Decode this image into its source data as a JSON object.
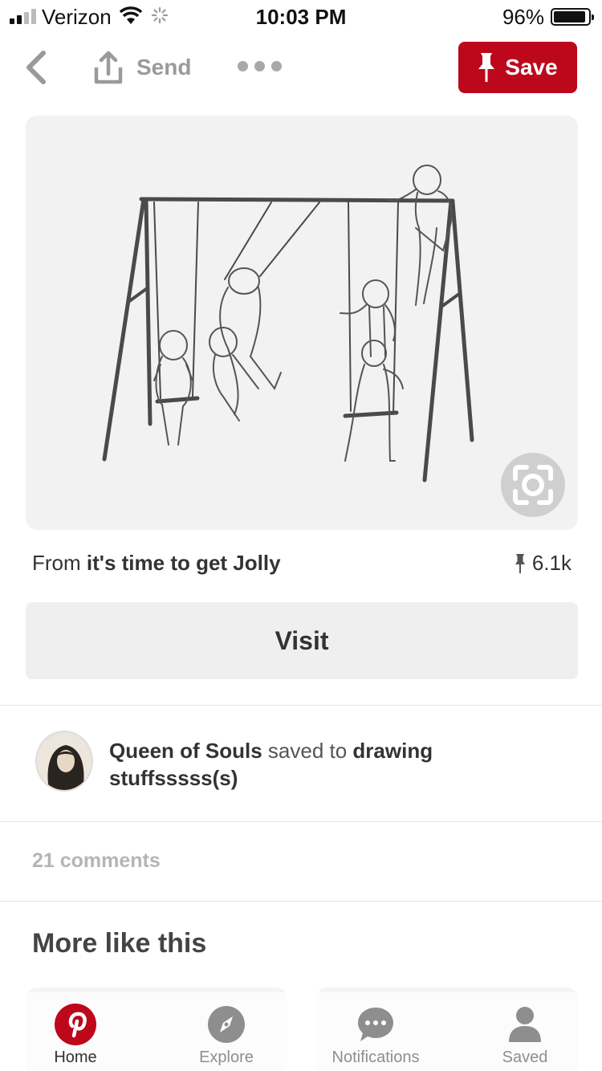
{
  "status_bar": {
    "carrier": "Verizon",
    "time": "10:03 PM",
    "battery": "96%",
    "battery_level": 0.96
  },
  "top_nav": {
    "send_label": "Send",
    "save_label": "Save",
    "save_color": "#bd081c"
  },
  "pin": {
    "source_prefix": "From ",
    "source_name": "it's time to get Jolly",
    "save_count": "6.1k",
    "visit_label": "Visit"
  },
  "attribution": {
    "user_name": "Queen of Souls",
    "saved_to": " saved to ",
    "board_name": "drawing stuffsssss(s)"
  },
  "comments": {
    "label": "21 comments"
  },
  "more_like_this": {
    "title": "More like this"
  },
  "tab_bar": {
    "tabs": [
      {
        "label": "Home",
        "icon": "pinterest-logo-icon"
      },
      {
        "label": "Explore",
        "icon": "compass-icon"
      },
      {
        "label": "Notifications",
        "icon": "speech-bubble-icon"
      },
      {
        "label": "Saved",
        "icon": "person-icon"
      }
    ]
  }
}
